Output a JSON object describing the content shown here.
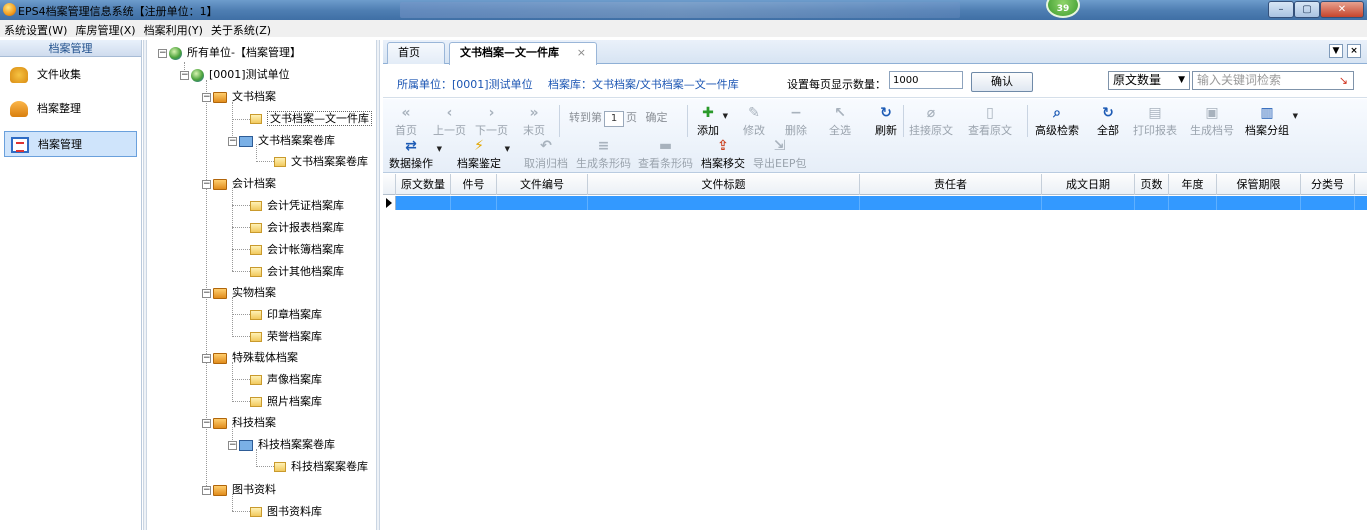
{
  "window": {
    "title": "EPS4档案管理信息系统【注册单位：1】",
    "badge": "39",
    "min": "–",
    "max": "▢",
    "close": "✕"
  },
  "menu": [
    "系统设置(W)",
    "库房管理(X)",
    "档案利用(Y)",
    "关于系统(Z)"
  ],
  "leftnav": {
    "header": "档案管理",
    "items": [
      {
        "label": "文件收集"
      },
      {
        "label": "档案整理"
      },
      {
        "label": "档案管理"
      }
    ]
  },
  "tree": {
    "root": "所有单位-【档案管理】",
    "unit": "[0001]测试单位",
    "doc_group": "文书档案",
    "doc_lib1": "文书档案—文一件库",
    "doc_vol": "文书档案案卷库",
    "doc_vol_child": "文书档案案卷库",
    "acc_group": "会计档案",
    "acc1": "会计凭证档案库",
    "acc2": "会计报表档案库",
    "acc3": "会计帐簿档案库",
    "acc4": "会计其他档案库",
    "obj_group": "实物档案",
    "obj1": "印章档案库",
    "obj2": "荣誉档案库",
    "sp_group": "特殊载体档案",
    "sp1": "声像档案库",
    "sp2": "照片档案库",
    "tech_group": "科技档案",
    "tech_vol": "科技档案案卷库",
    "tech_vol_child": "科技档案案卷库",
    "book_group": "图书资料",
    "book1": "图书资料库"
  },
  "tabs": {
    "home": "首页",
    "active": "文书档案—文一件库",
    "close": "×",
    "list": "▼",
    "closeall": "×"
  },
  "filter": {
    "unit_label": "所属单位：[0001]测试单位",
    "lib_label": "档案库：文书档案/文书档案—文一件库",
    "pagesize_label": "设置每页显示数量：",
    "pagesize_value": "1000",
    "confirm": "确认",
    "field_select": "原文数量",
    "keyword_placeholder": "输入关键词检索"
  },
  "toolbar": {
    "first": "首页",
    "prev": "上一页",
    "next": "下一页",
    "last": "末页",
    "jump_prefix": "转到第",
    "jump_value": "1",
    "jump_suffix": "页",
    "jump_ok": "确定",
    "add": "添加",
    "edit": "修改",
    "delete": "删除",
    "select_all": "全选",
    "refresh": "刷新",
    "attach": "挂接原文",
    "view_orig": "查看原文",
    "adv_search": "高级检索",
    "all": "全部",
    "print": "打印报表",
    "gen_no": "生成档号",
    "group": "档案分组",
    "data_ops": "数据操作",
    "appraise": "档案鉴定",
    "cancel_file": "取消归档",
    "gen_barcode": "生成条形码",
    "view_barcode": "查看条形码",
    "transfer": "档案移交",
    "export_eep": "导出EEP包"
  },
  "grid": {
    "columns": [
      "原文数量",
      "件号",
      "文件编号",
      "文件标题",
      "责任者",
      "成文日期",
      "页数",
      "年度",
      "保管期限",
      "分类号"
    ]
  },
  "icons": {
    "collect": "folder-gear-icon",
    "organize": "person-folder-icon",
    "manage": "checklist-icon",
    "globe": "globe-icon",
    "folder": "folder-icon",
    "book": "book-icon",
    "leaf": "file-folder-icon"
  },
  "colors": {
    "accent": "#3399ff",
    "link": "#1b55b3",
    "title_bar": "#4f7fb3"
  }
}
